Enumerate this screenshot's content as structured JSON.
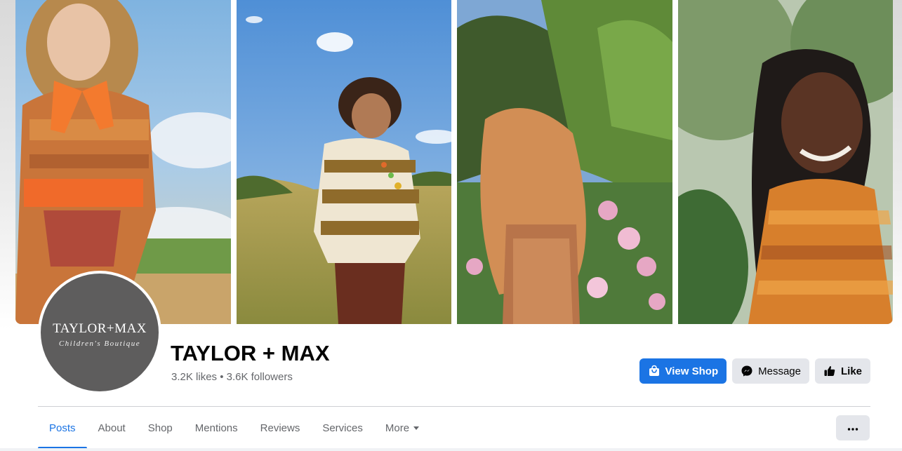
{
  "page": {
    "name": "TAYLOR + MAX",
    "stats": "3.2K likes • 3.6K followers"
  },
  "avatar": {
    "logo_main": "TAYLOR+MAX",
    "logo_sub": "Children's Boutique"
  },
  "actions": {
    "view_shop": "View Shop",
    "message": "Message",
    "like": "Like"
  },
  "tabs": [
    {
      "label": "Posts",
      "active": true
    },
    {
      "label": "About"
    },
    {
      "label": "Shop"
    },
    {
      "label": "Mentions"
    },
    {
      "label": "Reviews"
    },
    {
      "label": "Services"
    },
    {
      "label": "More"
    }
  ],
  "icons": {
    "view_shop": "shopping-bag-icon",
    "message": "messenger-icon",
    "like": "thumbs-up-icon",
    "more": "ellipsis-icon",
    "tab_more": "caret-down-icon"
  },
  "colors": {
    "accent": "#1b74e4",
    "secondary_button": "#e4e6eb",
    "muted_text": "#65676b",
    "avatar_bg": "#5e5d5d"
  }
}
